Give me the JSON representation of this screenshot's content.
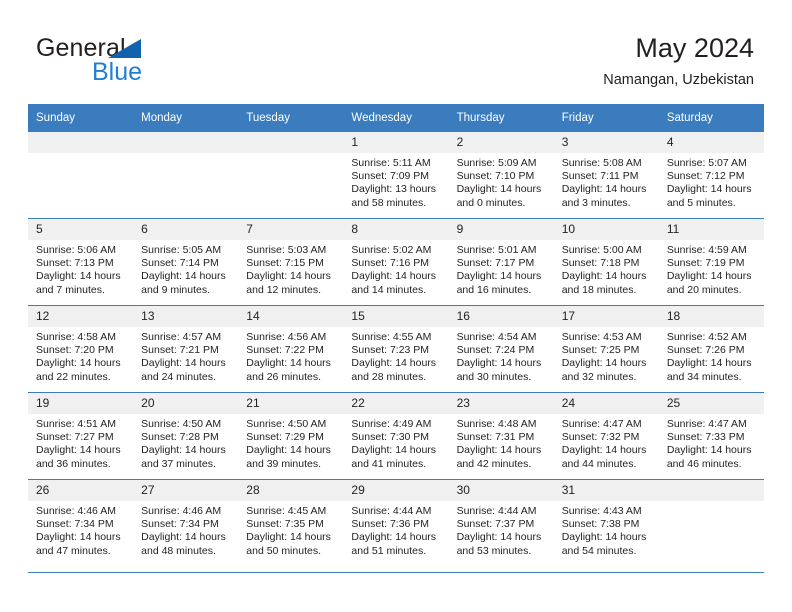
{
  "brand": {
    "name_part1": "General",
    "name_part2": "Blue",
    "triangle_icon": "triangle-icon",
    "accent_blue": "#1f7fd4",
    "logo_triangle_color": "#1263ad"
  },
  "header": {
    "title": "May 2024",
    "subtitle": "Namangan, Uzbekistan"
  },
  "theme": {
    "header_row_bg": "#3a7cbe",
    "daynum_bg": "#f0f0f0",
    "text_color": "#231f20"
  },
  "calendar": {
    "weekday_headers": [
      "Sunday",
      "Monday",
      "Tuesday",
      "Wednesday",
      "Thursday",
      "Friday",
      "Saturday"
    ],
    "labels": {
      "sunrise": "Sunrise:",
      "sunset": "Sunset:",
      "daylight": "Daylight:"
    },
    "weeks": [
      [
        {
          "day": "",
          "sunrise": "",
          "sunset": "",
          "daylight_line1": "",
          "daylight_line2": ""
        },
        {
          "day": "",
          "sunrise": "",
          "sunset": "",
          "daylight_line1": "",
          "daylight_line2": ""
        },
        {
          "day": "",
          "sunrise": "",
          "sunset": "",
          "daylight_line1": "",
          "daylight_line2": ""
        },
        {
          "day": "1",
          "sunrise": "Sunrise: 5:11 AM",
          "sunset": "Sunset: 7:09 PM",
          "daylight_line1": "Daylight: 13 hours",
          "daylight_line2": "and 58 minutes."
        },
        {
          "day": "2",
          "sunrise": "Sunrise: 5:09 AM",
          "sunset": "Sunset: 7:10 PM",
          "daylight_line1": "Daylight: 14 hours",
          "daylight_line2": "and 0 minutes."
        },
        {
          "day": "3",
          "sunrise": "Sunrise: 5:08 AM",
          "sunset": "Sunset: 7:11 PM",
          "daylight_line1": "Daylight: 14 hours",
          "daylight_line2": "and 3 minutes."
        },
        {
          "day": "4",
          "sunrise": "Sunrise: 5:07 AM",
          "sunset": "Sunset: 7:12 PM",
          "daylight_line1": "Daylight: 14 hours",
          "daylight_line2": "and 5 minutes."
        }
      ],
      [
        {
          "day": "5",
          "sunrise": "Sunrise: 5:06 AM",
          "sunset": "Sunset: 7:13 PM",
          "daylight_line1": "Daylight: 14 hours",
          "daylight_line2": "and 7 minutes."
        },
        {
          "day": "6",
          "sunrise": "Sunrise: 5:05 AM",
          "sunset": "Sunset: 7:14 PM",
          "daylight_line1": "Daylight: 14 hours",
          "daylight_line2": "and 9 minutes."
        },
        {
          "day": "7",
          "sunrise": "Sunrise: 5:03 AM",
          "sunset": "Sunset: 7:15 PM",
          "daylight_line1": "Daylight: 14 hours",
          "daylight_line2": "and 12 minutes."
        },
        {
          "day": "8",
          "sunrise": "Sunrise: 5:02 AM",
          "sunset": "Sunset: 7:16 PM",
          "daylight_line1": "Daylight: 14 hours",
          "daylight_line2": "and 14 minutes."
        },
        {
          "day": "9",
          "sunrise": "Sunrise: 5:01 AM",
          "sunset": "Sunset: 7:17 PM",
          "daylight_line1": "Daylight: 14 hours",
          "daylight_line2": "and 16 minutes."
        },
        {
          "day": "10",
          "sunrise": "Sunrise: 5:00 AM",
          "sunset": "Sunset: 7:18 PM",
          "daylight_line1": "Daylight: 14 hours",
          "daylight_line2": "and 18 minutes."
        },
        {
          "day": "11",
          "sunrise": "Sunrise: 4:59 AM",
          "sunset": "Sunset: 7:19 PM",
          "daylight_line1": "Daylight: 14 hours",
          "daylight_line2": "and 20 minutes."
        }
      ],
      [
        {
          "day": "12",
          "sunrise": "Sunrise: 4:58 AM",
          "sunset": "Sunset: 7:20 PM",
          "daylight_line1": "Daylight: 14 hours",
          "daylight_line2": "and 22 minutes."
        },
        {
          "day": "13",
          "sunrise": "Sunrise: 4:57 AM",
          "sunset": "Sunset: 7:21 PM",
          "daylight_line1": "Daylight: 14 hours",
          "daylight_line2": "and 24 minutes."
        },
        {
          "day": "14",
          "sunrise": "Sunrise: 4:56 AM",
          "sunset": "Sunset: 7:22 PM",
          "daylight_line1": "Daylight: 14 hours",
          "daylight_line2": "and 26 minutes."
        },
        {
          "day": "15",
          "sunrise": "Sunrise: 4:55 AM",
          "sunset": "Sunset: 7:23 PM",
          "daylight_line1": "Daylight: 14 hours",
          "daylight_line2": "and 28 minutes."
        },
        {
          "day": "16",
          "sunrise": "Sunrise: 4:54 AM",
          "sunset": "Sunset: 7:24 PM",
          "daylight_line1": "Daylight: 14 hours",
          "daylight_line2": "and 30 minutes."
        },
        {
          "day": "17",
          "sunrise": "Sunrise: 4:53 AM",
          "sunset": "Sunset: 7:25 PM",
          "daylight_line1": "Daylight: 14 hours",
          "daylight_line2": "and 32 minutes."
        },
        {
          "day": "18",
          "sunrise": "Sunrise: 4:52 AM",
          "sunset": "Sunset: 7:26 PM",
          "daylight_line1": "Daylight: 14 hours",
          "daylight_line2": "and 34 minutes."
        }
      ],
      [
        {
          "day": "19",
          "sunrise": "Sunrise: 4:51 AM",
          "sunset": "Sunset: 7:27 PM",
          "daylight_line1": "Daylight: 14 hours",
          "daylight_line2": "and 36 minutes."
        },
        {
          "day": "20",
          "sunrise": "Sunrise: 4:50 AM",
          "sunset": "Sunset: 7:28 PM",
          "daylight_line1": "Daylight: 14 hours",
          "daylight_line2": "and 37 minutes."
        },
        {
          "day": "21",
          "sunrise": "Sunrise: 4:50 AM",
          "sunset": "Sunset: 7:29 PM",
          "daylight_line1": "Daylight: 14 hours",
          "daylight_line2": "and 39 minutes."
        },
        {
          "day": "22",
          "sunrise": "Sunrise: 4:49 AM",
          "sunset": "Sunset: 7:30 PM",
          "daylight_line1": "Daylight: 14 hours",
          "daylight_line2": "and 41 minutes."
        },
        {
          "day": "23",
          "sunrise": "Sunrise: 4:48 AM",
          "sunset": "Sunset: 7:31 PM",
          "daylight_line1": "Daylight: 14 hours",
          "daylight_line2": "and 42 minutes."
        },
        {
          "day": "24",
          "sunrise": "Sunrise: 4:47 AM",
          "sunset": "Sunset: 7:32 PM",
          "daylight_line1": "Daylight: 14 hours",
          "daylight_line2": "and 44 minutes."
        },
        {
          "day": "25",
          "sunrise": "Sunrise: 4:47 AM",
          "sunset": "Sunset: 7:33 PM",
          "daylight_line1": "Daylight: 14 hours",
          "daylight_line2": "and 46 minutes."
        }
      ],
      [
        {
          "day": "26",
          "sunrise": "Sunrise: 4:46 AM",
          "sunset": "Sunset: 7:34 PM",
          "daylight_line1": "Daylight: 14 hours",
          "daylight_line2": "and 47 minutes."
        },
        {
          "day": "27",
          "sunrise": "Sunrise: 4:46 AM",
          "sunset": "Sunset: 7:34 PM",
          "daylight_line1": "Daylight: 14 hours",
          "daylight_line2": "and 48 minutes."
        },
        {
          "day": "28",
          "sunrise": "Sunrise: 4:45 AM",
          "sunset": "Sunset: 7:35 PM",
          "daylight_line1": "Daylight: 14 hours",
          "daylight_line2": "and 50 minutes."
        },
        {
          "day": "29",
          "sunrise": "Sunrise: 4:44 AM",
          "sunset": "Sunset: 7:36 PM",
          "daylight_line1": "Daylight: 14 hours",
          "daylight_line2": "and 51 minutes."
        },
        {
          "day": "30",
          "sunrise": "Sunrise: 4:44 AM",
          "sunset": "Sunset: 7:37 PM",
          "daylight_line1": "Daylight: 14 hours",
          "daylight_line2": "and 53 minutes."
        },
        {
          "day": "31",
          "sunrise": "Sunrise: 4:43 AM",
          "sunset": "Sunset: 7:38 PM",
          "daylight_line1": "Daylight: 14 hours",
          "daylight_line2": "and 54 minutes."
        },
        {
          "day": "",
          "sunrise": "",
          "sunset": "",
          "daylight_line1": "",
          "daylight_line2": ""
        }
      ]
    ]
  }
}
